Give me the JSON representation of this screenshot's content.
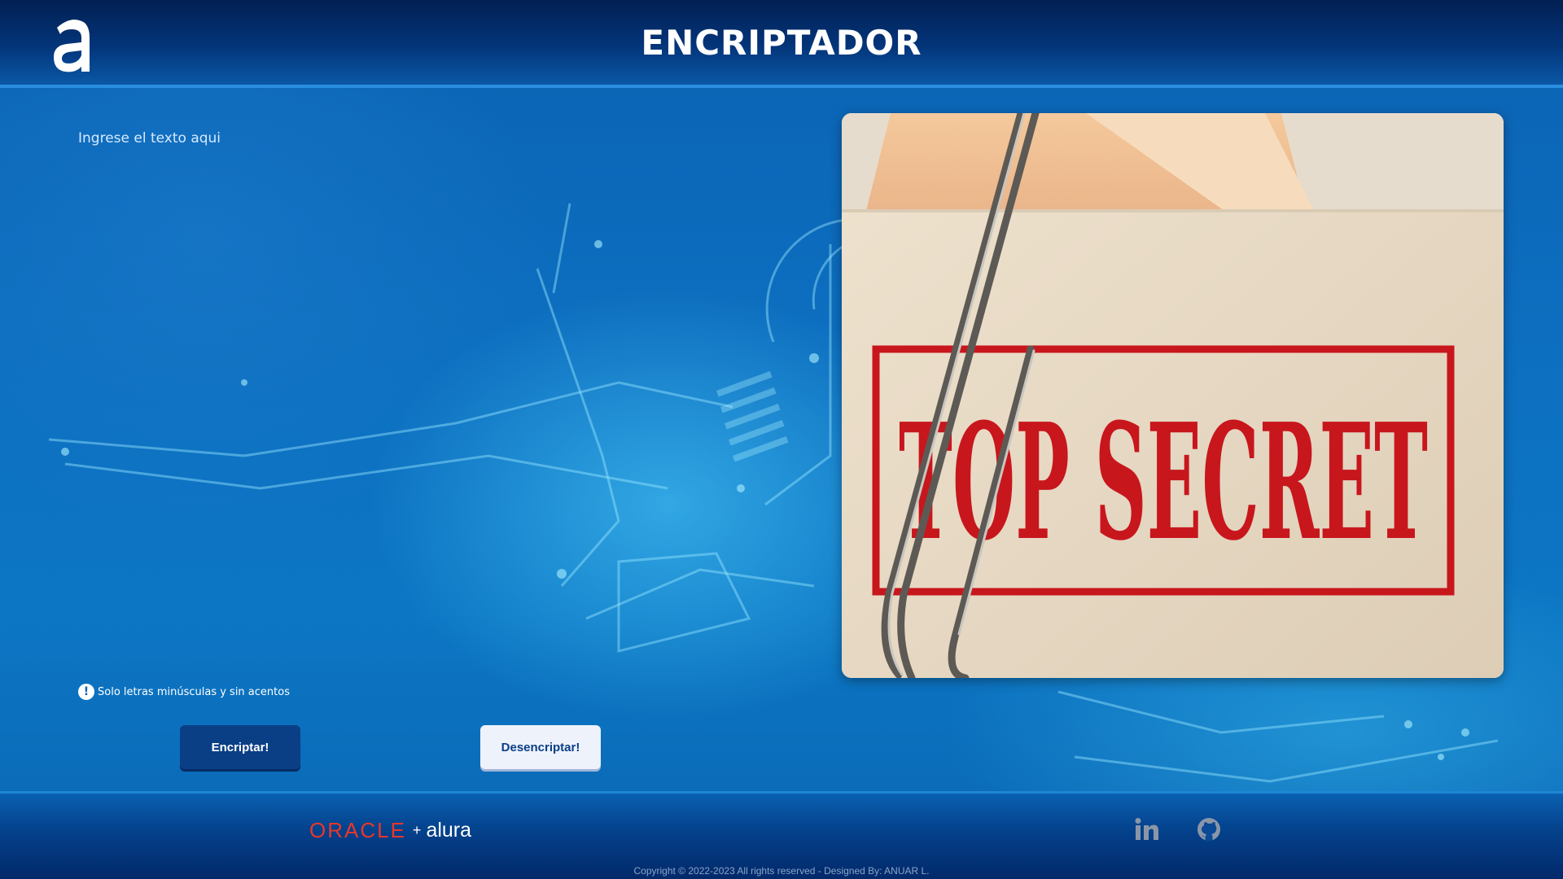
{
  "header": {
    "title": "ENCRIPTADOR",
    "logo_icon": "alura-logo-icon"
  },
  "main": {
    "input_placeholder": "Ingrese el texto aqui",
    "input_value": "",
    "warning_text": "Solo letras minúsculas y sin acentos",
    "warning_icon": "exclamation-circle-icon",
    "encrypt_label": "Encriptar!",
    "decrypt_label": "Desencriptar!",
    "image_stamp_text": "TOP SECRET"
  },
  "footer": {
    "brand_oracle": "ORACLE",
    "brand_plus": "+",
    "brand_alura": "alura",
    "social": [
      "linkedin-icon",
      "github-icon"
    ],
    "copyright": "Copyright © 2022-2023 All rights reserved - Designed By: ANUAR L."
  },
  "colors": {
    "header_dark": "#021f52",
    "background_blue": "#0b62b3",
    "encrypt_button": "#0a3f86",
    "decrypt_button": "#eef2fb",
    "oracle_red": "#e8372a",
    "stamp_red": "#c8161d"
  }
}
